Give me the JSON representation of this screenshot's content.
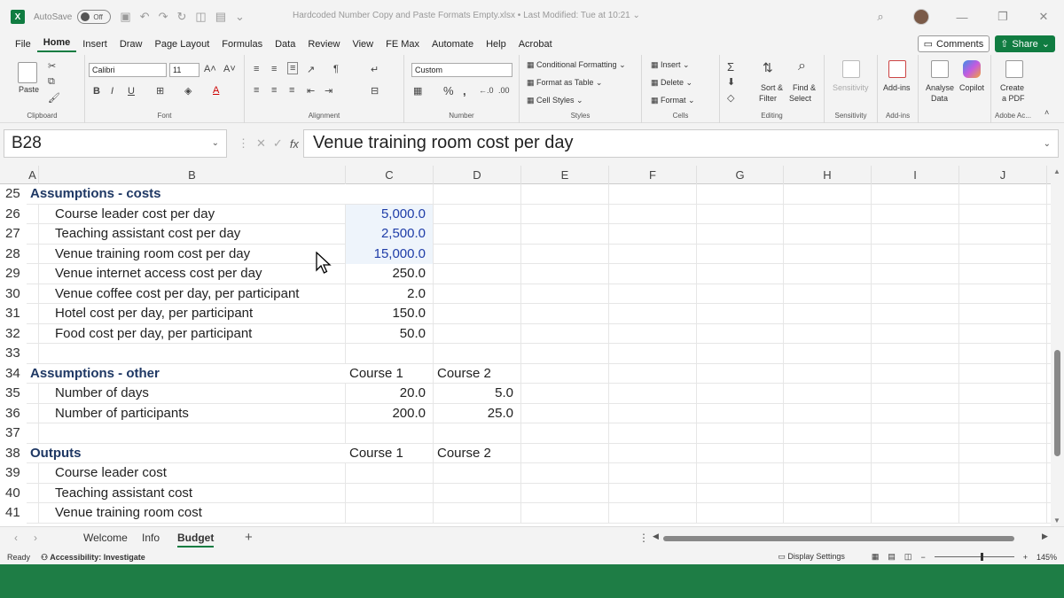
{
  "titlebar": {
    "autosave": "AutoSave",
    "toggle": "Off",
    "doc_title": "Hardcoded Number Copy and Paste Formats Empty.xlsx • Last Modified: Tue at 10:21 ⌄"
  },
  "menu": {
    "items": [
      "File",
      "Home",
      "Insert",
      "Draw",
      "Page Layout",
      "Formulas",
      "Data",
      "Review",
      "View",
      "FE Max",
      "Automate",
      "Help",
      "Acrobat"
    ],
    "active": "Home",
    "comments": "Comments",
    "share": "Share"
  },
  "ribbon": {
    "clipboard": {
      "label": "Clipboard",
      "paste": "Paste"
    },
    "font": {
      "label": "Font",
      "name": "Calibri",
      "size": "11",
      "bold": "B",
      "italic": "I",
      "underline": "U"
    },
    "alignment": {
      "label": "Alignment"
    },
    "number": {
      "label": "Number",
      "format": "Custom"
    },
    "styles": {
      "label": "Styles",
      "conditional": "Conditional Formatting",
      "format_table": "Format as Table",
      "cell_styles": "Cell Styles"
    },
    "cells": {
      "label": "Cells",
      "insert": "Insert",
      "delete": "Delete",
      "format": "Format"
    },
    "editing": {
      "label": "Editing",
      "sort1": "Sort &",
      "sort2": "Filter",
      "find1": "Find &",
      "find2": "Select"
    },
    "sensitivity": {
      "label": "Sensitivity",
      "btn": "Sensitivity"
    },
    "addins": {
      "label": "Add-ins",
      "btn": "Add-ins"
    },
    "analyse": {
      "l1": "Analyse",
      "l2": "Data"
    },
    "copilot": {
      "l1": "Copilot"
    },
    "adobe": {
      "label": "Adobe Ac...",
      "l1": "Create",
      "l2": "a PDF"
    }
  },
  "formula_bar": {
    "name_box": "B28",
    "formula": "Venue training room cost per day"
  },
  "columns": [
    "A",
    "B",
    "C",
    "D",
    "E",
    "F",
    "G",
    "H",
    "I",
    "J"
  ],
  "rows": [
    {
      "num": "25",
      "a": "Assumptions - costs",
      "b": "",
      "c": "",
      "d": "",
      "a_style": "heading"
    },
    {
      "num": "26",
      "a": "",
      "b": "Course leader cost per day",
      "c": "5,000.0",
      "d": "",
      "c_input": true
    },
    {
      "num": "27",
      "a": "",
      "b": "Teaching assistant cost per day",
      "c": "2,500.0",
      "d": "",
      "c_input": true
    },
    {
      "num": "28",
      "a": "",
      "b": "Venue training room cost per day",
      "c": "15,000.0",
      "d": "",
      "c_input": true
    },
    {
      "num": "29",
      "a": "",
      "b": "Venue internet access cost per day",
      "c": "250.0",
      "d": ""
    },
    {
      "num": "30",
      "a": "",
      "b": "Venue coffee cost per day, per participant",
      "c": "2.0",
      "d": ""
    },
    {
      "num": "31",
      "a": "",
      "b": "Hotel cost per day, per participant",
      "c": "150.0",
      "d": ""
    },
    {
      "num": "32",
      "a": "",
      "b": "Food cost per day, per participant",
      "c": "50.0",
      "d": ""
    },
    {
      "num": "33",
      "a": "",
      "b": "",
      "c": "",
      "d": ""
    },
    {
      "num": "34",
      "a": "Assumptions - other",
      "b": "",
      "c": "Course 1",
      "d": "Course 2",
      "a_style": "heading",
      "c_text": true
    },
    {
      "num": "35",
      "a": "",
      "b": "Number of days",
      "c": "20.0",
      "d": "5.0"
    },
    {
      "num": "36",
      "a": "",
      "b": "Number of participants",
      "c": "200.0",
      "d": "25.0"
    },
    {
      "num": "37",
      "a": "",
      "b": "",
      "c": "",
      "d": ""
    },
    {
      "num": "38",
      "a": "Outputs",
      "b": "",
      "c": "Course 1",
      "d": "Course 2",
      "a_style": "heading",
      "c_text": true
    },
    {
      "num": "39",
      "a": "",
      "b": "Course leader cost",
      "c": "",
      "d": ""
    },
    {
      "num": "40",
      "a": "",
      "b": "Teaching assistant cost",
      "c": "",
      "d": ""
    },
    {
      "num": "41",
      "a": "",
      "b": "Venue training room cost",
      "c": "",
      "d": ""
    }
  ],
  "sheets": {
    "tabs": [
      "Welcome",
      "Info",
      "Budget"
    ],
    "active": "Budget"
  },
  "status": {
    "ready": "Ready",
    "accessibility": "Accessibility: Investigate",
    "display_settings": "Display Settings",
    "zoom": "145%"
  },
  "colors": {
    "excel_green": "#107c41",
    "input_blue": "#1f3da8",
    "heading_navy": "#1f3864"
  }
}
